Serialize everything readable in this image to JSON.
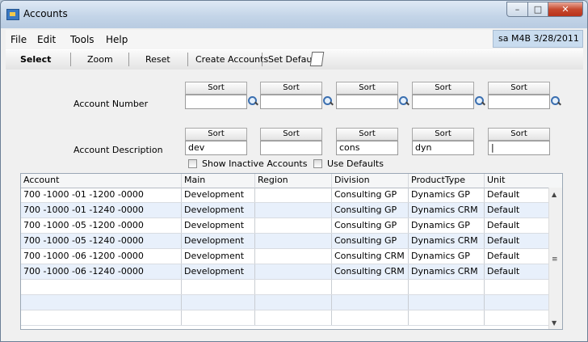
{
  "window": {
    "title": "Accounts"
  },
  "menu": {
    "items": [
      "File",
      "Edit",
      "Tools",
      "Help"
    ]
  },
  "userinfo": "sa  M4B  3/28/2011",
  "toolbar": {
    "select": "Select",
    "zoom": "Zoom",
    "reset": "Reset",
    "create_accounts": "Create Accounts",
    "set_default": "Set Default"
  },
  "filters": {
    "sort_label": "Sort",
    "account_number_label": "Account Number",
    "account_description_label": "Account Description",
    "account_number_values": [
      "",
      "",
      "",
      "",
      ""
    ],
    "description_values": [
      "dev",
      "",
      "cons",
      "dyn",
      "|"
    ],
    "show_inactive_label": "Show Inactive Accounts",
    "use_defaults_label": "Use Defaults"
  },
  "grid": {
    "columns": [
      "Account",
      "Main",
      "Region",
      "Division",
      "ProductType",
      "Unit"
    ],
    "rows": [
      [
        "700 -1000 -01 -1200 -0000",
        "Development",
        "",
        "Consulting GP",
        "Dynamics GP",
        "Default"
      ],
      [
        "700 -1000 -01 -1240 -0000",
        "Development",
        "",
        "Consulting GP",
        "Dynamics CRM",
        "Default"
      ],
      [
        "700 -1000 -05 -1200 -0000",
        "Development",
        "",
        "Consulting GP",
        "Dynamics GP",
        "Default"
      ],
      [
        "700 -1000 -05 -1240 -0000",
        "Development",
        "",
        "Consulting GP",
        "Dynamics CRM",
        "Default"
      ],
      [
        "700 -1000 -06 -1200 -0000",
        "Development",
        "",
        "Consulting CRM",
        "Dynamics GP",
        "Default"
      ],
      [
        "700 -1000 -06 -1240 -0000",
        "Development",
        "",
        "Consulting CRM",
        "Dynamics CRM",
        "Default"
      ],
      [
        "",
        "",
        "",
        "",
        "",
        ""
      ],
      [
        "",
        "",
        "",
        "",
        "",
        ""
      ],
      [
        "",
        "",
        "",
        "",
        "",
        ""
      ]
    ]
  }
}
